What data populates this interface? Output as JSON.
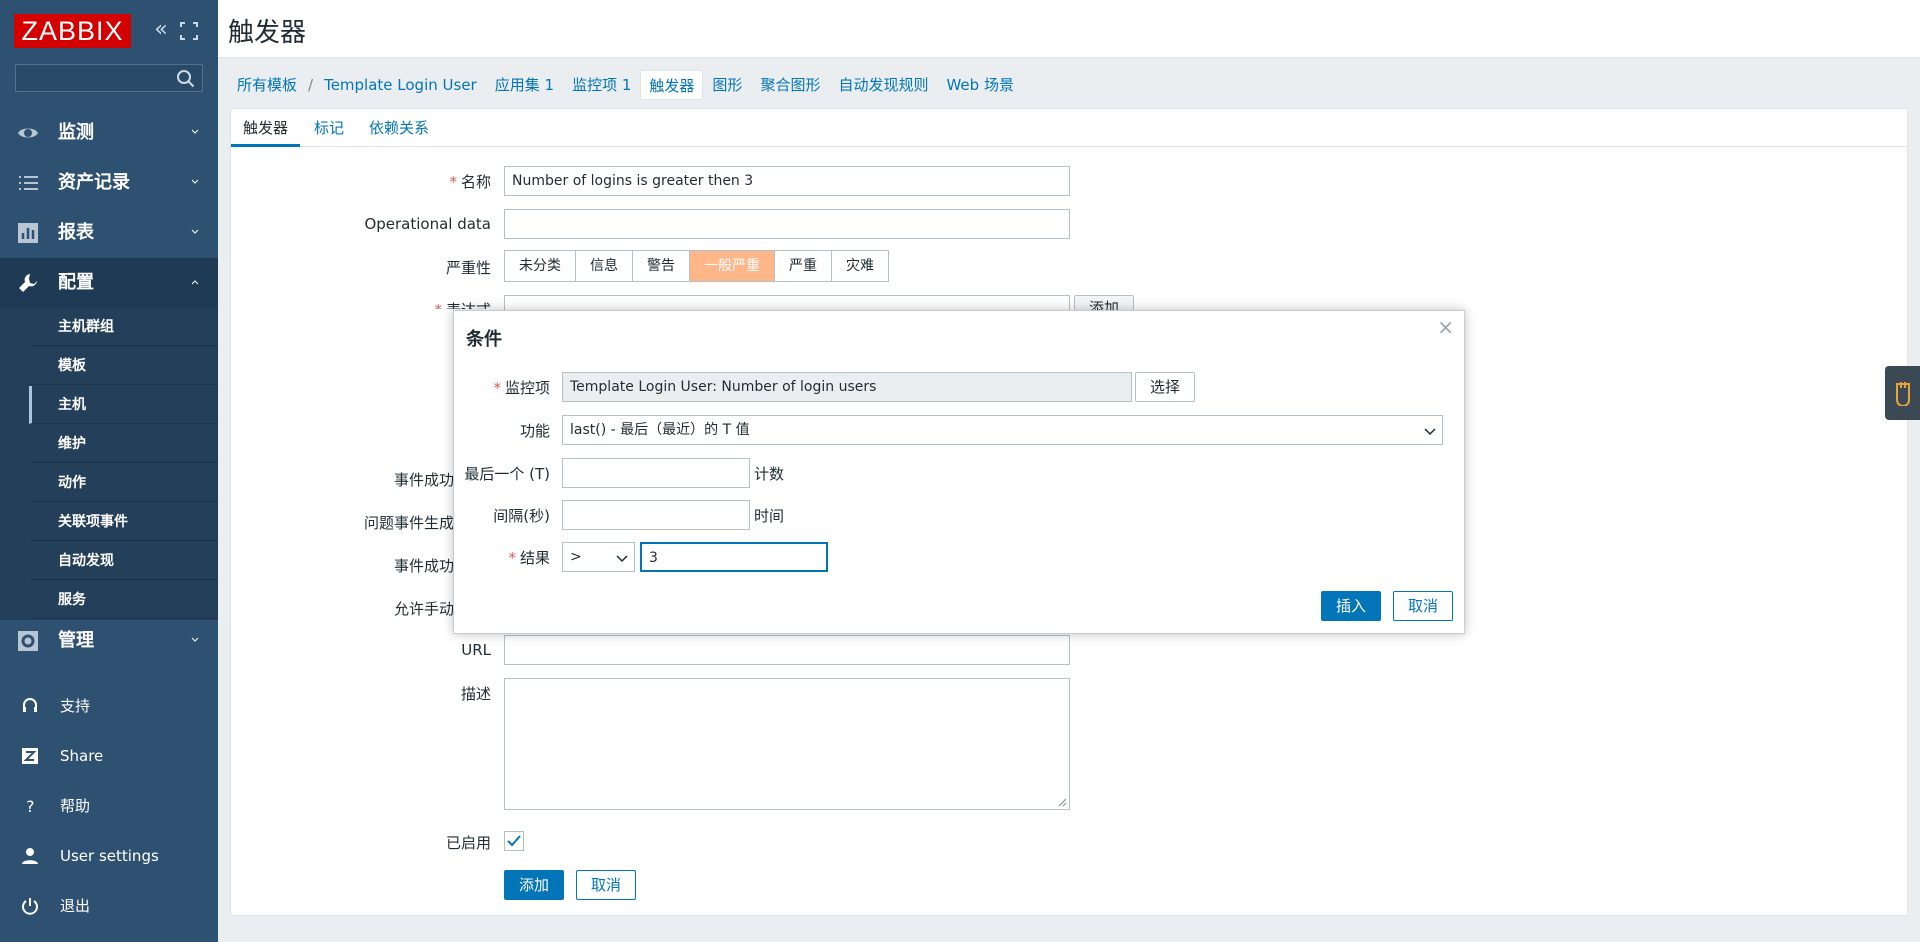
{
  "sidebar": {
    "logo": "ZABBIX",
    "menu": [
      {
        "label": "监测",
        "icon": "eye-icon"
      },
      {
        "label": "资产记录",
        "icon": "list-icon"
      },
      {
        "label": "报表",
        "icon": "bar-chart-icon"
      },
      {
        "label": "配置",
        "icon": "wrench-icon"
      },
      {
        "label": "管理",
        "icon": "gear-icon"
      }
    ],
    "config_submenu": [
      "主机群组",
      "模板",
      "主机",
      "维护",
      "动作",
      "关联项事件",
      "自动发现",
      "服务"
    ],
    "bottom": [
      {
        "label": "支持",
        "icon": "headset-icon"
      },
      {
        "label": "Share",
        "icon": "share-icon"
      },
      {
        "label": "帮助",
        "icon": "question-icon"
      },
      {
        "label": "User settings",
        "icon": "user-icon"
      },
      {
        "label": "退出",
        "icon": "power-icon"
      }
    ]
  },
  "header": {
    "title": "触发器"
  },
  "breadcrumbs": {
    "all_templates": "所有模板",
    "template": "Template Login User",
    "applications": "应用集",
    "applications_count": "1",
    "items": "监控项",
    "items_count": "1",
    "triggers": "触发器",
    "graphs": "图形",
    "screens": "聚合图形",
    "discovery": "自动发现规则",
    "web": "Web 场景"
  },
  "tabs": [
    "触发器",
    "标记",
    "依赖关系"
  ],
  "form": {
    "name_label": "名称",
    "name_value": "Number of logins is greater then 3",
    "opdata_label": "Operational data",
    "opdata_value": "",
    "severity_label": "严重性",
    "severities": [
      "未分类",
      "信息",
      "警告",
      "一般严重",
      "严重",
      "灾难"
    ],
    "selected_severity": "一般严重",
    "expression_label": "表达式",
    "expression_add": "添加",
    "event_ok_label": "事件成功",
    "problem_gen_label": "问题事件生成",
    "event_ok_close_label": "事件成功",
    "manual_close_label": "允许手动",
    "url_label": "URL",
    "desc_label": "描述",
    "enabled_label": "已启用",
    "enabled": true,
    "add_button": "添加",
    "cancel_button": "取消"
  },
  "modal": {
    "title": "条件",
    "item_label": "监控项",
    "item_value": "Template Login User: Number of login users",
    "select_button": "选择",
    "function_label": "功能",
    "function_value": "last() - 最后（最近）的 T 值",
    "last_t_label": "最后一个 (T)",
    "last_t_value": "",
    "last_t_suffix": "计数",
    "interval_label": "间隔(秒)",
    "interval_value": "",
    "interval_suffix": "时间",
    "result_label": "结果",
    "result_operator": ">",
    "result_value": "3",
    "insert_button": "插入",
    "cancel_button": "取消"
  },
  "colors": {
    "sidebar": "#2f5171",
    "accent": "#0275b8",
    "severity_average": "#ffb689",
    "logo": "#d40000"
  }
}
